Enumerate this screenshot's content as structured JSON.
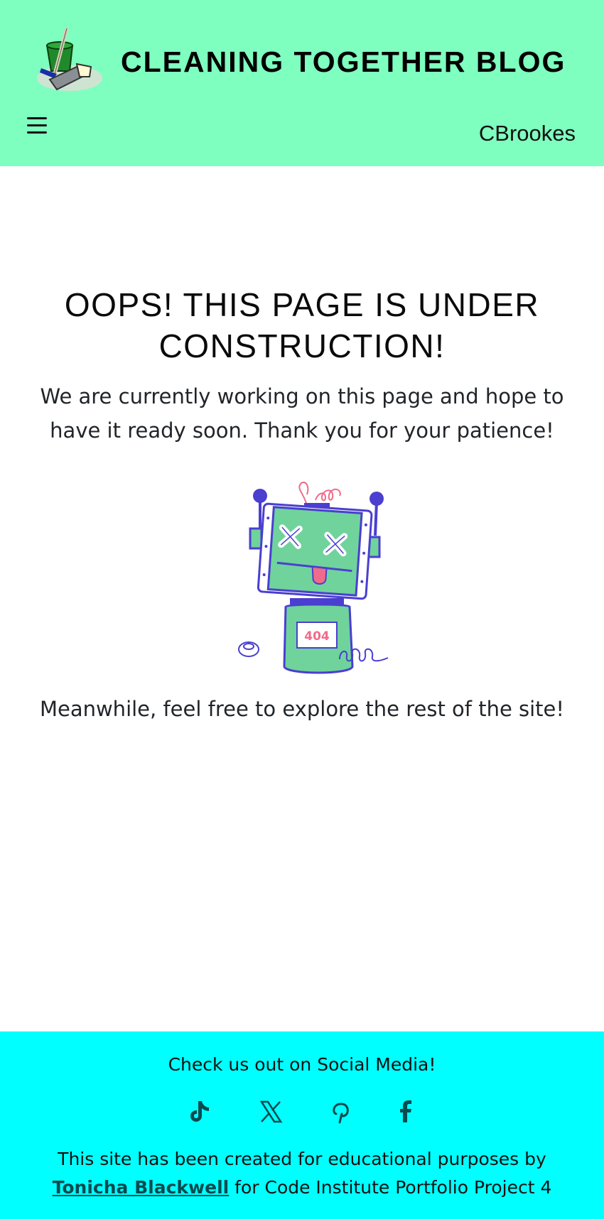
{
  "header": {
    "title": "CLEANING TOGETHER BLOG",
    "username": "CBrookes",
    "logo_icon": "cleaning-bucket-logo",
    "menu_icon": "hamburger-menu-icon"
  },
  "main": {
    "heading": "OOPS! THIS PAGE IS UNDER CONSTRUCTION!",
    "message": "We are currently working on this page and hope to have it ready soon. Thank you for your patience!",
    "illustration_text": "404",
    "explore": "Meanwhile, feel free to explore the rest of the site!"
  },
  "footer": {
    "heading": "Check us out on Social Media!",
    "social": [
      "tiktok-icon",
      "x-icon",
      "pinterest-icon",
      "facebook-icon"
    ],
    "credit_before": "This site has been created for educational purposes by ",
    "credit_author": "Tonicha Blackwell",
    "credit_after": " for Code Institute Portfolio Project 4"
  },
  "colors": {
    "header_bg": "#7fffbf",
    "footer_bg": "#00ffff",
    "robot_green": "#6fd39b",
    "robot_outline": "#4a3fcf",
    "accent_pink": "#f06b8a"
  }
}
